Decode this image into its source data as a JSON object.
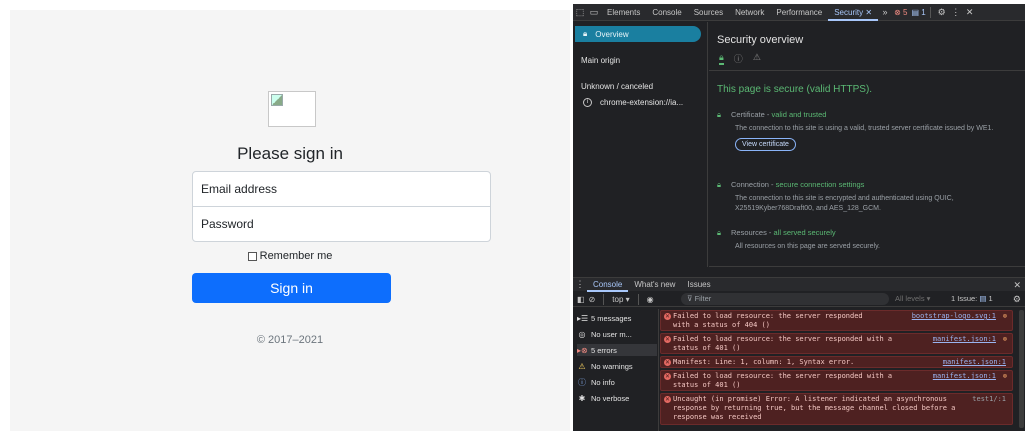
{
  "login": {
    "title": "Please sign in",
    "email_placeholder": "Email address",
    "password_placeholder": "Password",
    "remember_label": "Remember me",
    "signin_label": "Sign in",
    "copyright": "© 2017–2021",
    "accent_color": "#0d6efd"
  },
  "devtools": {
    "tabs": [
      "Elements",
      "Console",
      "Sources",
      "Network",
      "Performance",
      "Security"
    ],
    "active_tab": "Security",
    "more_label": "»",
    "error_count": "5",
    "message_count": "1",
    "security": {
      "sidebar": {
        "overview": "Overview",
        "main_origin": "Main origin",
        "unknown": "Unknown / canceled",
        "extension": "chrome-extension://ia..."
      },
      "title": "Security overview",
      "secure_text": "This page is secure (valid HTTPS).",
      "certificate": {
        "label": "Certificate - ",
        "status": "valid and trusted",
        "desc": "The connection to this site is using a valid, trusted server certificate issued by WE1.",
        "button": "View certificate"
      },
      "connection": {
        "label": "Connection - ",
        "status": "secure connection settings",
        "desc": "The connection to this site is encrypted and authenticated using QUIC, X25519Kyber768Draft00, and AES_128_GCM."
      },
      "resources": {
        "label": "Resources - ",
        "status": "all served securely",
        "desc": "All resources on this page are served securely."
      }
    },
    "drawer": {
      "tabs": [
        "Console",
        "What's new",
        "Issues"
      ],
      "context": "top ▾",
      "filter_placeholder": "Filter",
      "levels": "All levels ▾",
      "issues": "1 Issue:",
      "issues_count": "1"
    },
    "console_sidebar": [
      {
        "label": "5 messages",
        "icon": "list-icon"
      },
      {
        "label": "No user m...",
        "icon": "user-icon"
      },
      {
        "label": "5 errors",
        "icon": "error-icon"
      },
      {
        "label": "No warnings",
        "icon": "warning-icon"
      },
      {
        "label": "No info",
        "icon": "info-icon"
      },
      {
        "label": "No verbose",
        "icon": "bug-icon"
      }
    ],
    "messages": [
      {
        "text": "Failed to load resource: the server responded with a status of 404 ()",
        "link": "bootstrap-logo.svg:1"
      },
      {
        "text": "Failed to load resource: the server responded with a status of 401 ()",
        "link": "manifest.json:1"
      },
      {
        "text": "Manifest: Line: 1, column: 1, Syntax error.",
        "link": "manifest.json:1"
      },
      {
        "text": "Failed to load resource: the server responded with a status of 401 ()",
        "link": "manifest.json:1"
      },
      {
        "text": "Uncaught (in promise) Error: A listener indicated an asynchronous response by returning true, but the message channel closed before a response was received",
        "source": "test1/:1"
      }
    ]
  }
}
